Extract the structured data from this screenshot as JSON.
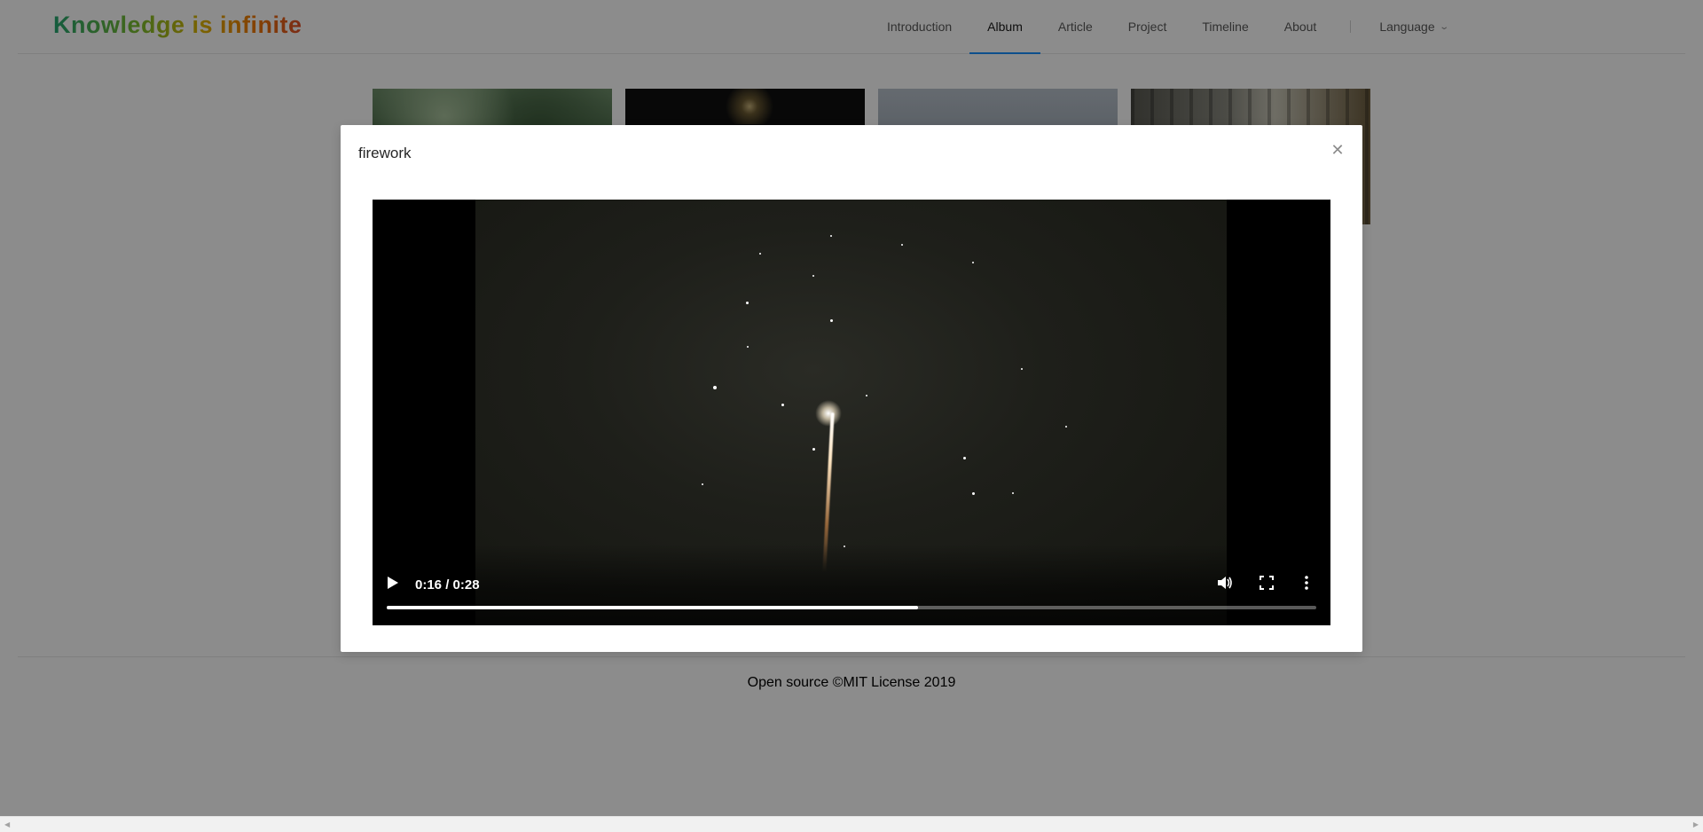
{
  "header": {
    "logo": "Knowledge is infinite",
    "nav": [
      {
        "label": "Introduction",
        "active": false
      },
      {
        "label": "Album",
        "active": true
      },
      {
        "label": "Article",
        "active": false
      },
      {
        "label": "Project",
        "active": false
      },
      {
        "label": "Timeline",
        "active": false
      },
      {
        "label": "About",
        "active": false
      }
    ],
    "language_label": "Language",
    "language_icon": "chevron-down-icon"
  },
  "album": {
    "thumbnails": [
      "photo-tree",
      "photo-firework",
      "photo-sky",
      "photo-train"
    ]
  },
  "modal": {
    "title": "firework",
    "close_icon": "close-icon",
    "video": {
      "current_time": "0:16",
      "duration": "0:28",
      "time_display": "0:16 / 0:28",
      "progress": 0.5714,
      "icons": [
        "play-icon",
        "volume-icon",
        "fullscreen-icon",
        "more-options-icon"
      ]
    }
  },
  "footer": {
    "text": "Open source ©MIT License 2019"
  },
  "colors": {
    "nav_active_underline": "#1890ff",
    "overlay": "rgba(0,0,0,0.45)"
  }
}
